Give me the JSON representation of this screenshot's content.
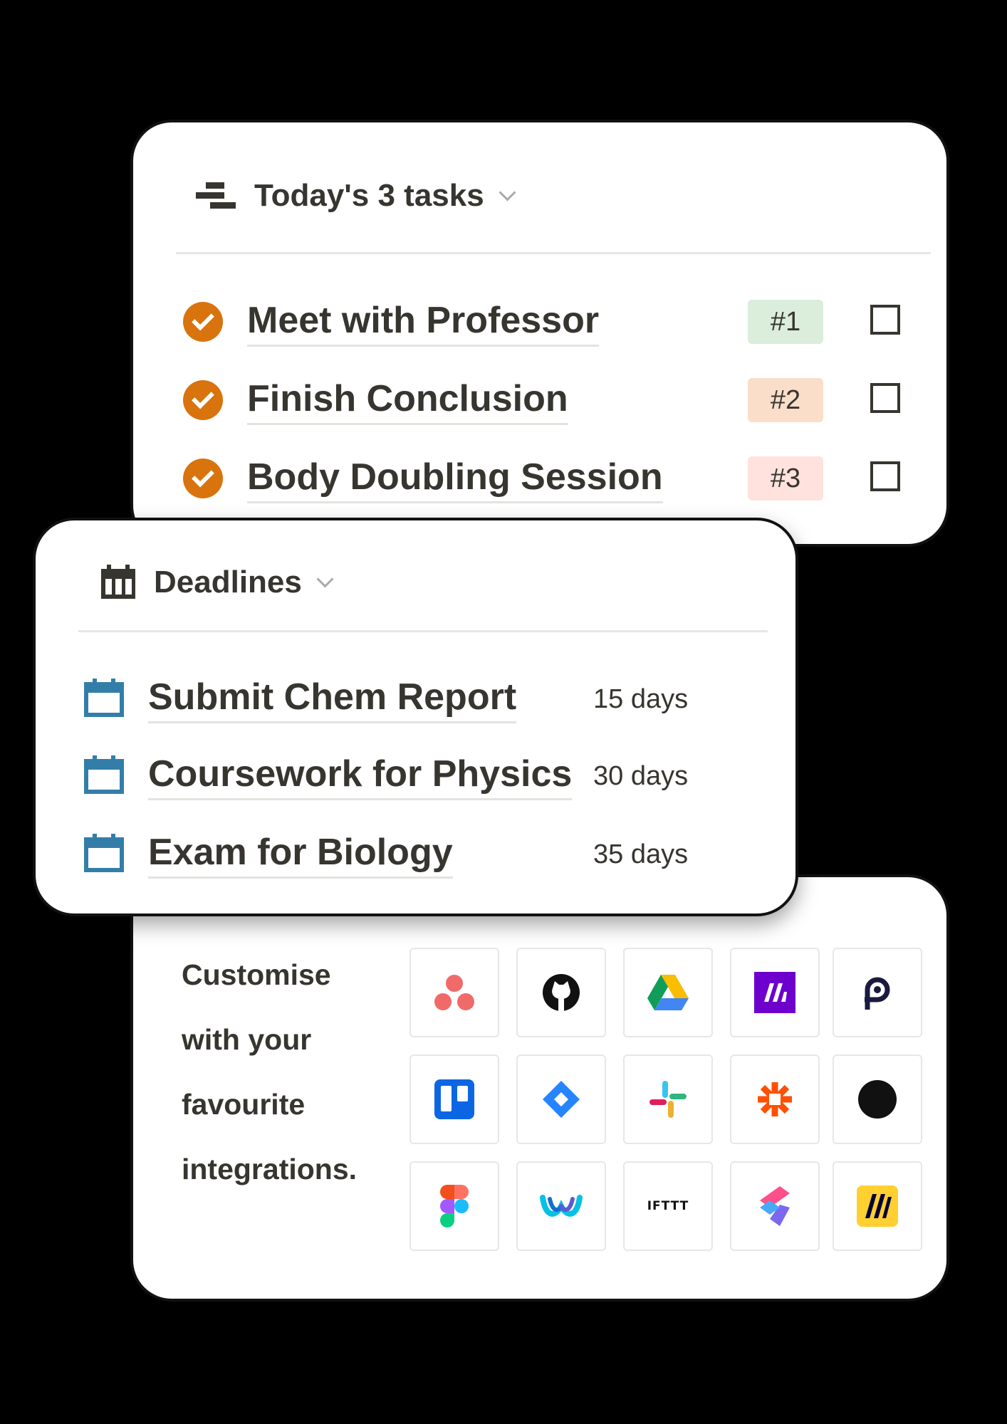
{
  "tasks": {
    "title": "Today's 3 tasks",
    "items": [
      {
        "name": "Meet with Professor",
        "badge": "#1",
        "badge_color": "#dbeddb"
      },
      {
        "name": "Finish Conclusion",
        "badge": "#2",
        "badge_color": "#fadec9"
      },
      {
        "name": "Body Doubling Session",
        "badge": "#3",
        "badge_color": "#ffe2dd"
      }
    ]
  },
  "deadlines": {
    "title": "Deadlines",
    "items": [
      {
        "name": "Submit Chem Report",
        "days": "15 days"
      },
      {
        "name": "Coursework for Physics",
        "days": "30 days"
      },
      {
        "name": "Exam for Biology",
        "days": "35 days"
      }
    ]
  },
  "integrations": {
    "copy_lines": [
      "Customise",
      "with your",
      "favourite",
      "integrations."
    ],
    "icons": [
      [
        "asana-icon",
        "github-icon",
        "google-drive-icon",
        "make-icon",
        "pipedream-icon"
      ],
      [
        "trello-icon",
        "jira-icon",
        "slack-icon",
        "zapier-icon",
        "dot-icon"
      ],
      [
        "figma-icon",
        "webex-icon",
        "ifttt-icon",
        "clickup-icon",
        "miro-icon"
      ]
    ],
    "ifttt_text": "IFTTT"
  },
  "colors": {
    "check_orange": "#d9730d",
    "calendar_blue": "#337ea9",
    "text": "#37352f"
  }
}
